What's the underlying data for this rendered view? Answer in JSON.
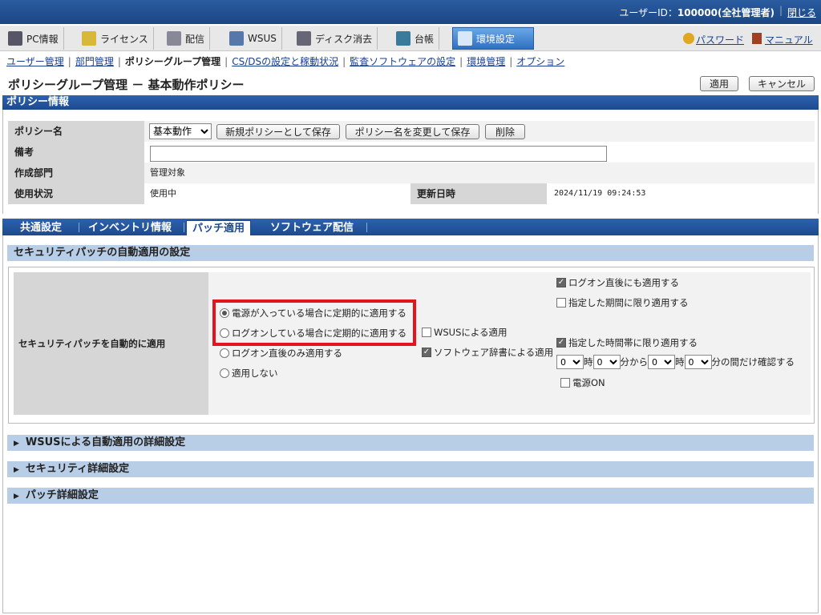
{
  "topbar": {
    "user_prefix": "ユーザーID：",
    "user_id": "100000(全社管理者)",
    "logout": "閉じる"
  },
  "menu": {
    "items": [
      {
        "label": "PC情報",
        "icon": "pc-icon"
      },
      {
        "label": "ライセンス",
        "icon": "license-icon"
      },
      {
        "label": "配信",
        "icon": "delivery-icon"
      },
      {
        "label": "WSUS",
        "icon": "wsus-icon"
      },
      {
        "label": "ディスク消去",
        "icon": "disk-erase-icon"
      },
      {
        "label": "台帳",
        "icon": "ledger-icon"
      },
      {
        "label": "環境設定",
        "icon": "settings-tools-icon"
      }
    ],
    "password": "パスワード",
    "manual": "マニュアル"
  },
  "subnav": {
    "items": [
      "ユーザー管理",
      "部門管理",
      "ポリシーグループ管理",
      "CS/DSの設定と稼動状況",
      "監査ソフトウェアの設定",
      "環境管理",
      "オプション"
    ]
  },
  "page": {
    "title": "ポリシーグループ管理 － 基本動作ポリシー",
    "apply": "適用",
    "cancel": "キャンセル"
  },
  "policy": {
    "section": "ポリシー情報",
    "name_label": "ポリシー名",
    "name_value": "基本動作",
    "save_new": "新規ポリシーとして保存",
    "rename_save": "ポリシー名を変更して保存",
    "delete": "削除",
    "note_label": "備考",
    "note_value": "",
    "dept_label": "作成部門",
    "dept_value": "管理対象",
    "status_label": "使用状況",
    "status_value": "使用中",
    "updated_label": "更新日時",
    "updated_value": "2024/11/19 09:24:53"
  },
  "tabs": [
    "共通設定",
    "インベントリ情報",
    "パッチ適用",
    "ソフトウェア配信"
  ],
  "patch": {
    "heading": "セキュリティパッチの自動適用の設定",
    "label": "セキュリティパッチを自動的に適用",
    "radio1": "電源が入っている場合に定期的に適用する",
    "radio2": "ログオンしている場合に定期的に適用する",
    "radio3": "ログオン直後のみ適用する",
    "radio4": "適用しない",
    "wsus": "WSUSによる適用",
    "dict": "ソフトウェア辞書による適用",
    "logon_after": "ログオン直後にも適用する",
    "period": "指定した期間に限り適用する",
    "timeband": "指定した時間帯に限り適用する",
    "hour_from": "0",
    "ji1": "時",
    "min_from": "0",
    "fun_kara": "分から",
    "hour_to": "0",
    "ji2": "時",
    "min_to": "0",
    "confirm": "分の間だけ確認する",
    "power_on": "電源ON"
  },
  "collapsibles": [
    "WSUSによる自動適用の詳細設定",
    "セキュリティ詳細設定",
    "パッチ詳細設定"
  ]
}
